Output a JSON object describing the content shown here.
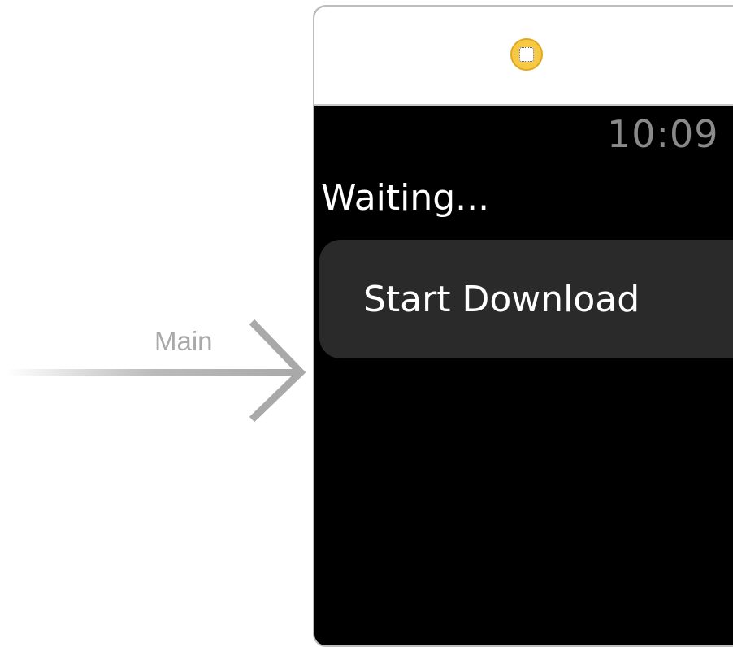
{
  "storyboard": {
    "entry_point_label": "Main"
  },
  "interface": {
    "time": "10:09",
    "status_label": "Waiting...",
    "button_label": "Start Download"
  },
  "colors": {
    "scene_background": "#000000",
    "button_background": "#2a2a2a",
    "controller_icon": "#f7c844",
    "entry_arrow": "#a9a9a9"
  },
  "icons": {
    "controller_icon": "interface-controller-icon",
    "entry_arrow": "storyboard-entry-arrow-icon"
  }
}
